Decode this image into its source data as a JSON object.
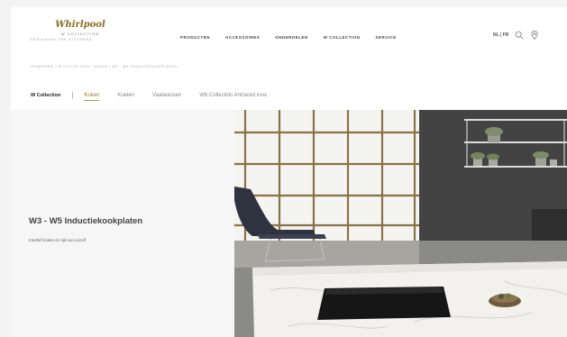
{
  "header": {
    "logo_name": "Whirlpool",
    "logo_tag": "W COLLECTION",
    "logo_sub": "DESIGNING THE KITCHENS",
    "nav": [
      "PRODUCTEN",
      "ACCESSOIRES",
      "ONDERDELEN",
      "W COLLECTION",
      "SERVICE"
    ],
    "lang": "NL | FR",
    "icons": [
      "search-icon",
      "location-pin-icon"
    ]
  },
  "breadcrumb": "HOMEPAGE / W COLLECTION / KOKEN / W3 - W5 INDUCTIEKOOKPLATEN",
  "subnav": {
    "brand": "W Collection",
    "tabs": [
      {
        "label": "Koken",
        "active": true
      },
      {
        "label": "Koelen",
        "active": false
      },
      {
        "label": "Vaatwassen",
        "active": false
      },
      {
        "label": "W6 Collection Antraciet inox",
        "active": false
      }
    ]
  },
  "hero": {
    "title": "W3 - W5 Inductiekookplaten",
    "subtitle": "Intuïtief koken en tijd voor jezelf"
  },
  "colors": {
    "accent": "#b5964a",
    "logo": "#8a6a1f"
  }
}
